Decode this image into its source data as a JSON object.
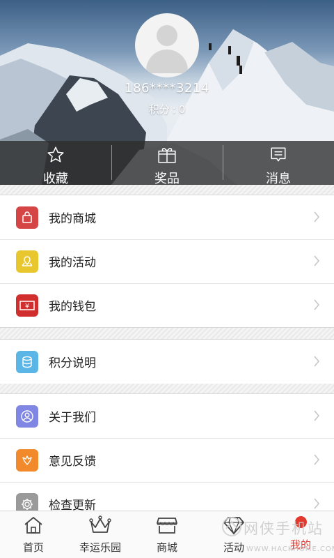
{
  "profile": {
    "phone": "186****3214",
    "points_label": "积分",
    "points_sep": ":",
    "points_value": "0"
  },
  "header_tabs": [
    {
      "label": "收藏",
      "icon": "star-icon"
    },
    {
      "label": "奖品",
      "icon": "gift-icon"
    },
    {
      "label": "消息",
      "icon": "message-icon"
    }
  ],
  "menu": {
    "group1": [
      {
        "label": "我的商城",
        "icon": "shopping-bag-icon",
        "color": "#d64545"
      },
      {
        "label": "我的活动",
        "icon": "location-icon",
        "color": "#e8c72e"
      },
      {
        "label": "我的钱包",
        "icon": "wallet-icon",
        "color": "#d12e2e"
      }
    ],
    "group2": [
      {
        "label": "积分说明",
        "icon": "coins-icon",
        "color": "#5bb6e6"
      }
    ],
    "group3": [
      {
        "label": "关于我们",
        "icon": "person-icon",
        "color": "#7f86e3"
      },
      {
        "label": "意见反馈",
        "icon": "feedback-icon",
        "color": "#f28a2c"
      },
      {
        "label": "检查更新",
        "icon": "gear-icon",
        "color": "#9a9a9a"
      }
    ]
  },
  "bottom_nav": [
    {
      "label": "首页",
      "icon": "home-icon"
    },
    {
      "label": "幸运乐园",
      "icon": "crown-icon"
    },
    {
      "label": "商城",
      "icon": "store-icon"
    },
    {
      "label": "活动",
      "icon": "diamond-icon"
    },
    {
      "label": "我的",
      "icon": "profile-icon",
      "active": true
    }
  ],
  "watermark": {
    "cn": "网侠手机站",
    "en": "WWW.HACKHOME.COM"
  },
  "colors": {
    "accent": "#e33a2f"
  }
}
